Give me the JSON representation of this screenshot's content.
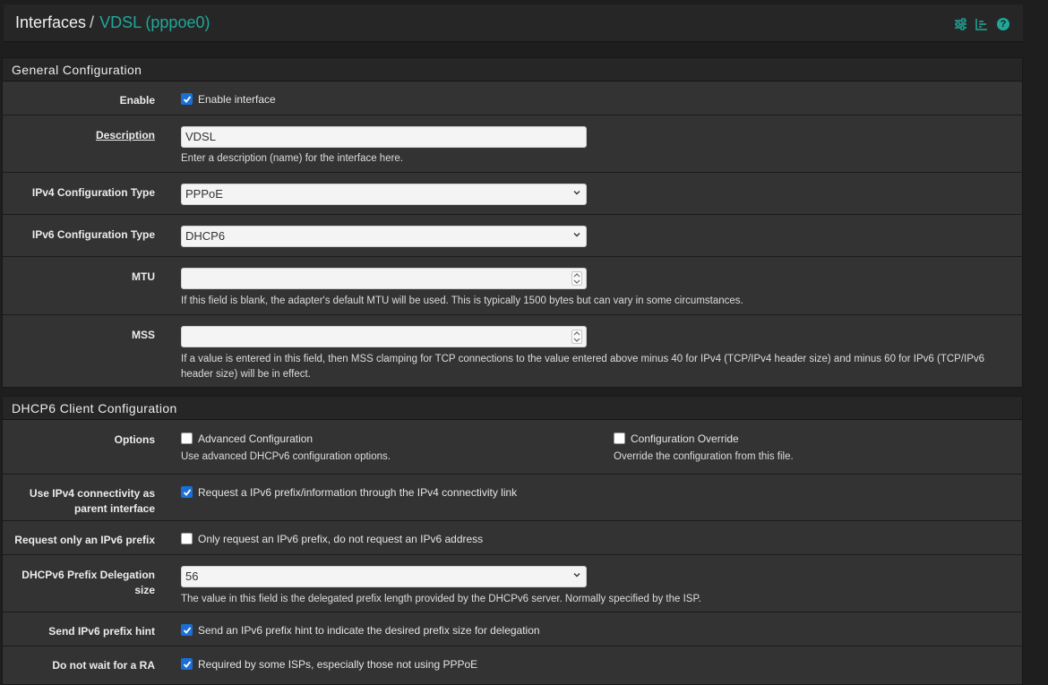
{
  "header": {
    "crumb_root": "Interfaces",
    "crumb_sep": "/",
    "crumb_current": "VDSL (pppoe0)",
    "icons": [
      "sliders-icon",
      "chart-icon",
      "help-icon"
    ],
    "help_glyph": "?"
  },
  "general": {
    "title": "General Configuration",
    "enable": {
      "label": "Enable",
      "checkbox_label": "Enable interface",
      "checked": true
    },
    "description": {
      "label": "Description",
      "value": "VDSL",
      "help": "Enter a description (name) for the interface here."
    },
    "ipv4_type": {
      "label": "IPv4 Configuration Type",
      "value": "PPPoE"
    },
    "ipv6_type": {
      "label": "IPv6 Configuration Type",
      "value": "DHCP6"
    },
    "mtu": {
      "label": "MTU",
      "value": "",
      "help": "If this field is blank, the adapter's default MTU will be used. This is typically 1500 bytes but can vary in some circumstances."
    },
    "mss": {
      "label": "MSS",
      "value": "",
      "help": "If a value is entered in this field, then MSS clamping for TCP connections to the value entered above minus 40 for IPv4 (TCP/IPv4 header size) and minus 60 for IPv6 (TCP/IPv6 header size) will be in effect."
    }
  },
  "dhcp6": {
    "title": "DHCP6 Client Configuration",
    "options": {
      "label": "Options",
      "advanced": {
        "checkbox_label": "Advanced Configuration",
        "help": "Use advanced DHCPv6 configuration options.",
        "checked": false
      },
      "override": {
        "checkbox_label": "Configuration Override",
        "help": "Override the configuration from this file.",
        "checked": false
      }
    },
    "use_ipv4": {
      "label_line1": "Use IPv4 connectivity as",
      "label_line2": "parent interface",
      "checkbox_label": "Request a IPv6 prefix/information through the IPv4 connectivity link",
      "checked": true
    },
    "prefix_only": {
      "label": "Request only an IPv6 prefix",
      "checkbox_label": "Only request an IPv6 prefix, do not request an IPv6 address",
      "checked": false
    },
    "pd_size": {
      "label_line1": "DHCPv6 Prefix Delegation",
      "label_line2": "size",
      "value": "56",
      "help": "The value in this field is the delegated prefix length provided by the DHCPv6 server. Normally specified by the ISP."
    },
    "prefix_hint": {
      "label": "Send IPv6 prefix hint",
      "checkbox_label": "Send an IPv6 prefix hint to indicate the desired prefix size for delegation",
      "checked": true
    },
    "no_wait_ra": {
      "label": "Do not wait for a RA",
      "checkbox_label": "Required by some ISPs, especially those not using PPPoE",
      "checked": true
    }
  }
}
